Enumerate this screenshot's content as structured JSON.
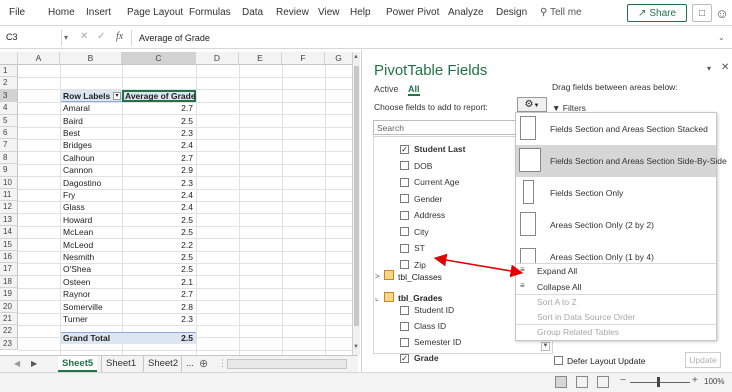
{
  "menu": {
    "items": [
      "File",
      "Home",
      "Insert",
      "Page Layout",
      "Formulas",
      "Data",
      "Review",
      "View",
      "Help",
      "Power Pivot",
      "Analyze",
      "Design"
    ],
    "tell_me": "Tell me",
    "share_label": "Share",
    "accent": "#217346"
  },
  "formula_bar": {
    "name_box": "C3",
    "fx": "fx",
    "content": "Average of Grade"
  },
  "grid": {
    "columns": [
      "A",
      "B",
      "C",
      "D",
      "E",
      "F",
      "G"
    ],
    "rows": [
      "1",
      "2",
      "3",
      "4",
      "5",
      "6",
      "7",
      "8",
      "9",
      "10",
      "11",
      "12",
      "13",
      "14",
      "15",
      "16",
      "17",
      "18",
      "19",
      "20",
      "21",
      "22",
      "23"
    ],
    "pivot": {
      "header_labels": "Row Labels",
      "header_values": "Average of Grade",
      "rows": [
        {
          "label": "Amaral",
          "value": "2.7"
        },
        {
          "label": "Baird",
          "value": "2.5"
        },
        {
          "label": "Best",
          "value": "2.3"
        },
        {
          "label": "Bridges",
          "value": "2.4"
        },
        {
          "label": "Calhoun",
          "value": "2.7"
        },
        {
          "label": "Cannon",
          "value": "2.9"
        },
        {
          "label": "Dagostino",
          "value": "2.3"
        },
        {
          "label": "Fry",
          "value": "2.4"
        },
        {
          "label": "Glass",
          "value": "2.4"
        },
        {
          "label": "Howard",
          "value": "2.5"
        },
        {
          "label": "McLean",
          "value": "2.5"
        },
        {
          "label": "McLeod",
          "value": "2.2"
        },
        {
          "label": "Nesmith",
          "value": "2.5"
        },
        {
          "label": "O'Shea",
          "value": "2.5"
        },
        {
          "label": "Osteen",
          "value": "2.1"
        },
        {
          "label": "Raynor",
          "value": "2.7"
        },
        {
          "label": "Somerville",
          "value": "2.8"
        },
        {
          "label": "Turner",
          "value": "2.3"
        }
      ],
      "grand_total_label": "Grand Total",
      "grand_total_value": "2.5"
    }
  },
  "sheet_tabs": {
    "tabs": [
      "Sheet5",
      "Sheet1",
      "Sheet2"
    ],
    "more": "...",
    "active": "Sheet5"
  },
  "pane": {
    "title": "PivotTable Fields",
    "tab_active": "Active",
    "tab_all": "All",
    "choose_label": "Choose fields to add to report:",
    "drag_label": "Drag fields between areas below:",
    "filters_label": "Filters",
    "search_placeholder": "Search",
    "fields": [
      {
        "label": "Student Last",
        "checked": true,
        "bold": true
      },
      {
        "label": "DOB",
        "checked": false
      },
      {
        "label": "Current Age",
        "checked": false
      },
      {
        "label": "Gender",
        "checked": false
      },
      {
        "label": "Address",
        "checked": false
      },
      {
        "label": "City",
        "checked": false
      },
      {
        "label": "ST",
        "checked": false
      },
      {
        "label": "Zip",
        "checked": false
      }
    ],
    "table_classes": "tbl_Classes",
    "table_grades": "tbl_Grades",
    "grade_fields": [
      {
        "label": "Student ID",
        "checked": false
      },
      {
        "label": "Class ID",
        "checked": false
      },
      {
        "label": "Semester ID",
        "checked": false
      },
      {
        "label": "Grade",
        "checked": true
      }
    ],
    "defer_label": "Defer Layout Update",
    "update_label": "Update"
  },
  "dropdown": {
    "items": [
      {
        "label": "Fields Section and Areas Section Stacked",
        "selected": false
      },
      {
        "label": "Fields Section and Areas Section Side-By-Side",
        "selected": true
      },
      {
        "label": "Fields Section Only",
        "selected": false
      },
      {
        "label": "Areas Section Only (2 by 2)",
        "selected": false
      },
      {
        "label": "Areas Section Only (1 by 4)",
        "selected": false
      }
    ],
    "expand_all": "Expand All",
    "collapse_all": "Collapse All",
    "sort_az": "Sort A to Z",
    "sort_source": "Sort in Data Source Order",
    "group_tables": "Group Related Tables"
  },
  "status": {
    "zoom": "100%"
  }
}
